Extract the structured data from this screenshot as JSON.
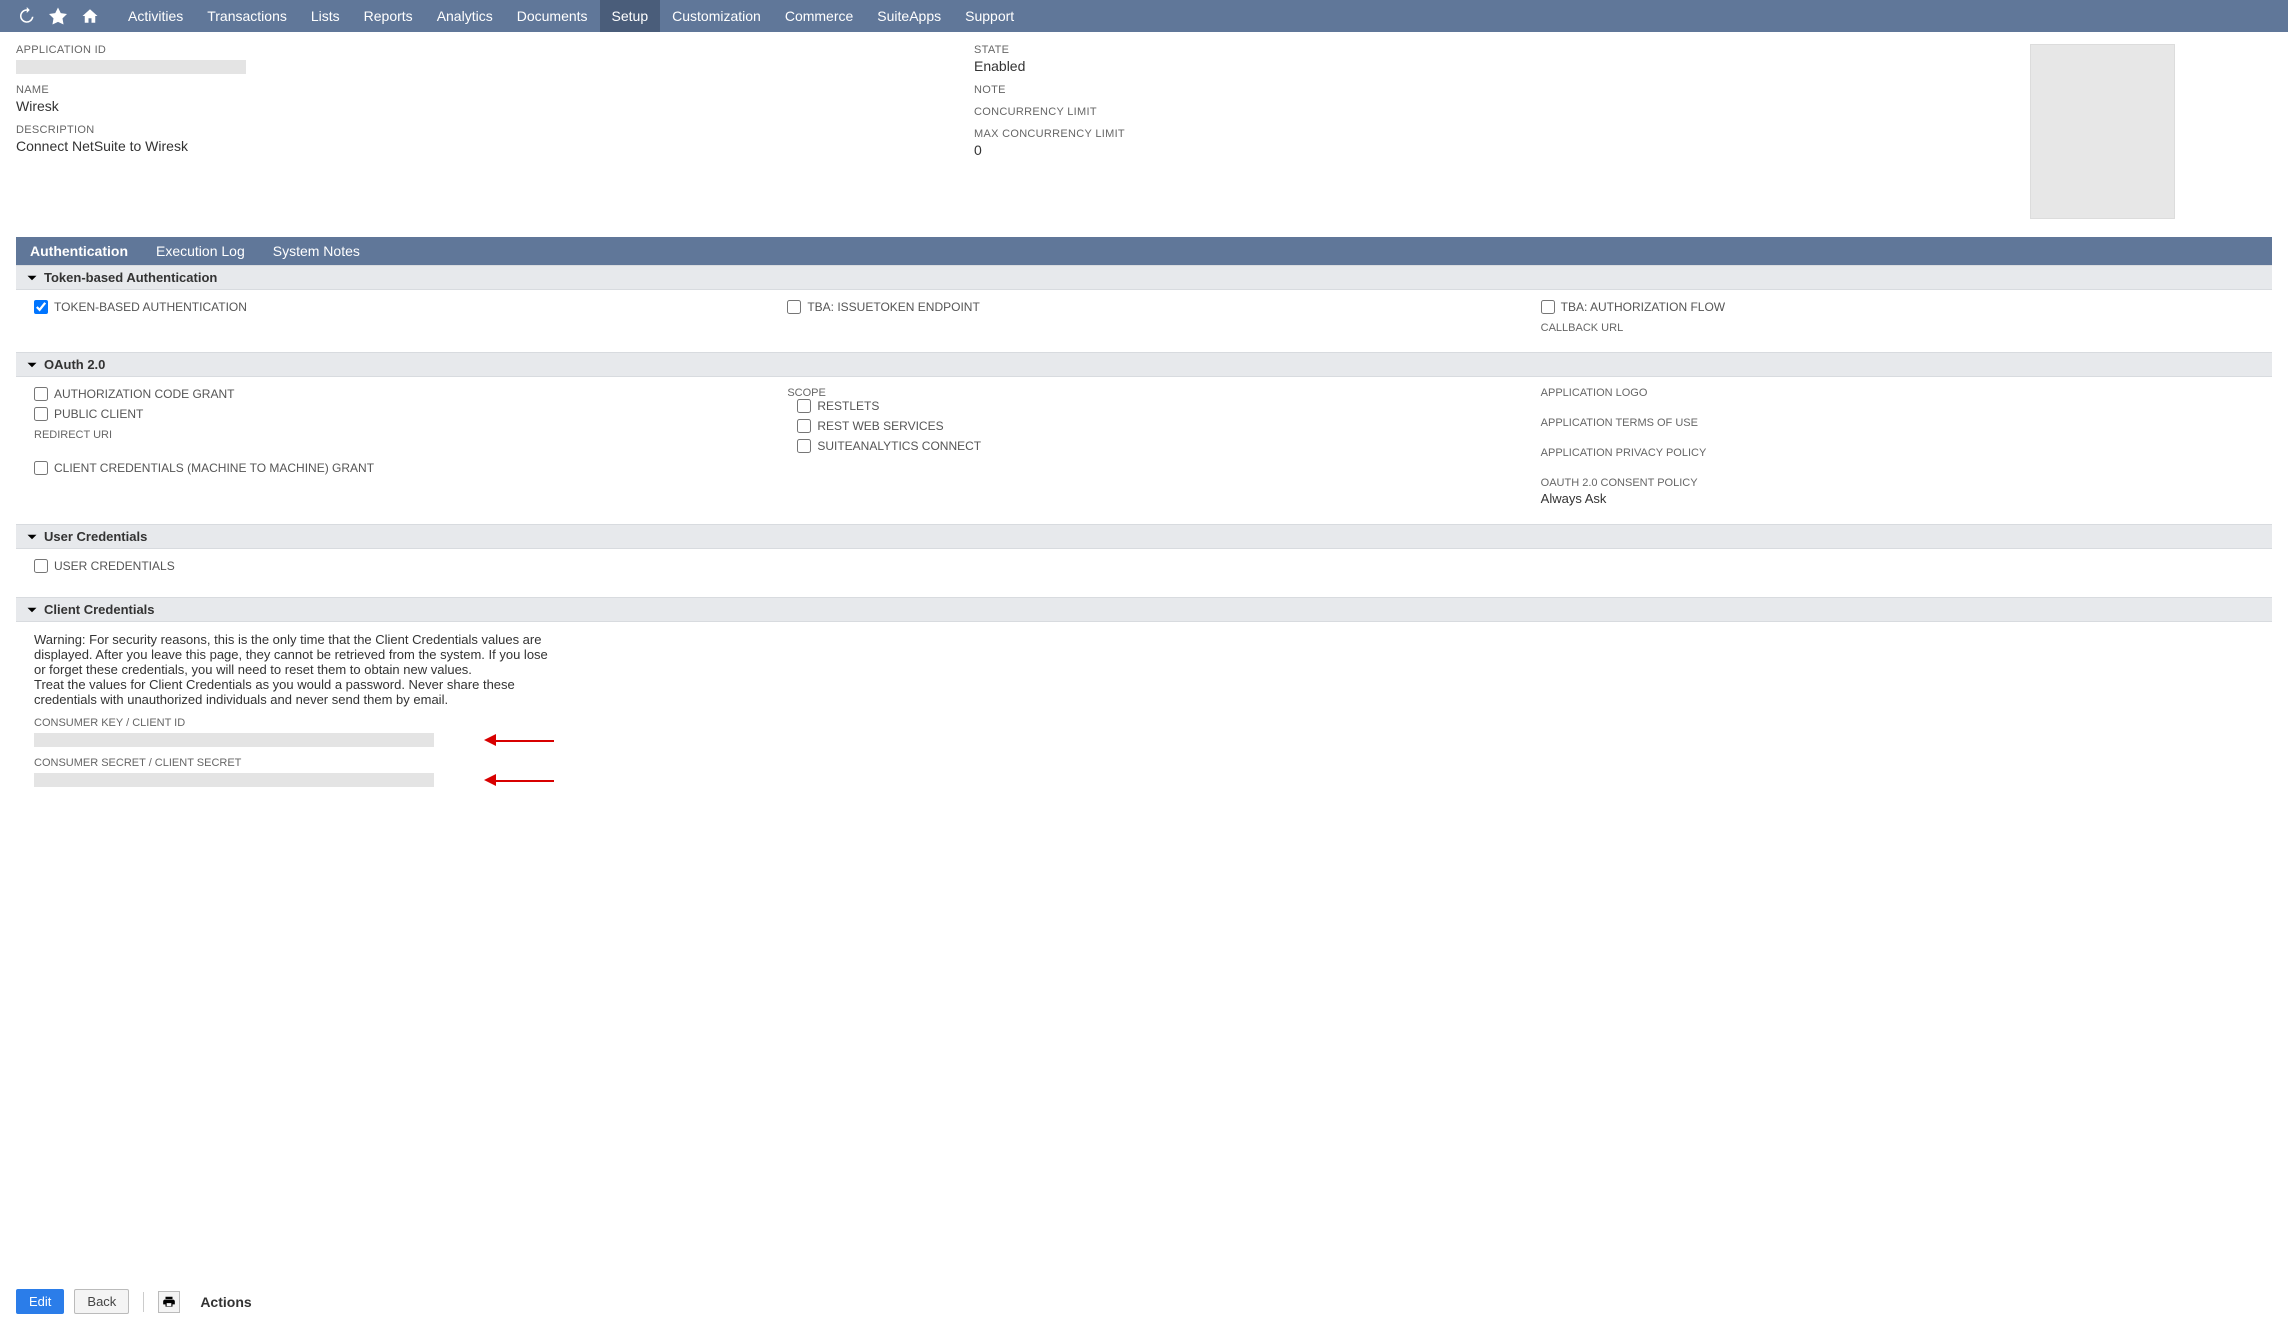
{
  "nav": {
    "items": [
      "Activities",
      "Transactions",
      "Lists",
      "Reports",
      "Analytics",
      "Documents",
      "Setup",
      "Customization",
      "Commerce",
      "SuiteApps",
      "Support"
    ],
    "active_index": 6
  },
  "summary": {
    "application_id_label": "APPLICATION ID",
    "name_label": "NAME",
    "name_value": "Wiresk",
    "description_label": "DESCRIPTION",
    "description_value": "Connect NetSuite to Wiresk",
    "state_label": "STATE",
    "state_value": "Enabled",
    "note_label": "NOTE",
    "concurrency_limit_label": "CONCURRENCY LIMIT",
    "max_concurrency_limit_label": "MAX CONCURRENCY LIMIT",
    "max_concurrency_limit_value": "0"
  },
  "subtabs": {
    "items": [
      "Authentication",
      "Execution Log",
      "System Notes"
    ],
    "active_index": 0
  },
  "section_tba": {
    "title": "Token-based Authentication",
    "token_based_auth_label": "TOKEN-BASED AUTHENTICATION",
    "token_based_auth_checked": true,
    "issuetoken_label": "TBA: ISSUETOKEN ENDPOINT",
    "issuetoken_checked": false,
    "auth_flow_label": "TBA: AUTHORIZATION FLOW",
    "auth_flow_checked": false,
    "callback_url_label": "CALLBACK URL"
  },
  "section_oauth": {
    "title": "OAuth 2.0",
    "auth_code_grant_label": "AUTHORIZATION CODE GRANT",
    "auth_code_grant_checked": false,
    "public_client_label": "PUBLIC CLIENT",
    "public_client_checked": false,
    "redirect_uri_label": "REDIRECT URI",
    "client_cred_grant_label": "CLIENT CREDENTIALS (MACHINE TO MACHINE) GRANT",
    "client_cred_grant_checked": false,
    "scope_label": "SCOPE",
    "restlets_label": "RESTLETS",
    "restlets_checked": false,
    "rest_ws_label": "REST WEB SERVICES",
    "rest_ws_checked": false,
    "sa_connect_label": "SUITEANALYTICS CONNECT",
    "sa_connect_checked": false,
    "app_logo_label": "APPLICATION LOGO",
    "app_terms_label": "APPLICATION TERMS OF USE",
    "app_privacy_label": "APPLICATION PRIVACY POLICY",
    "consent_policy_label": "OAUTH 2.0 CONSENT POLICY",
    "consent_policy_value": "Always Ask"
  },
  "section_user_cred": {
    "title": "User Credentials",
    "user_credentials_label": "USER CREDENTIALS",
    "user_credentials_checked": false
  },
  "section_client_cred": {
    "title": "Client Credentials",
    "warning": "Warning: For security reasons, this is the only time that the Client Credentials values are displayed. After you leave this page, they cannot be retrieved from the system. If you lose or forget these credentials, you will need to reset them to obtain new values.\nTreat the values for Client Credentials as you would a password. Never share these credentials with unauthorized individuals and never send them by email.",
    "consumer_key_label": "CONSUMER KEY / CLIENT ID",
    "consumer_secret_label": "CONSUMER SECRET / CLIENT SECRET"
  },
  "footer": {
    "edit_label": "Edit",
    "back_label": "Back",
    "actions_label": "Actions"
  }
}
